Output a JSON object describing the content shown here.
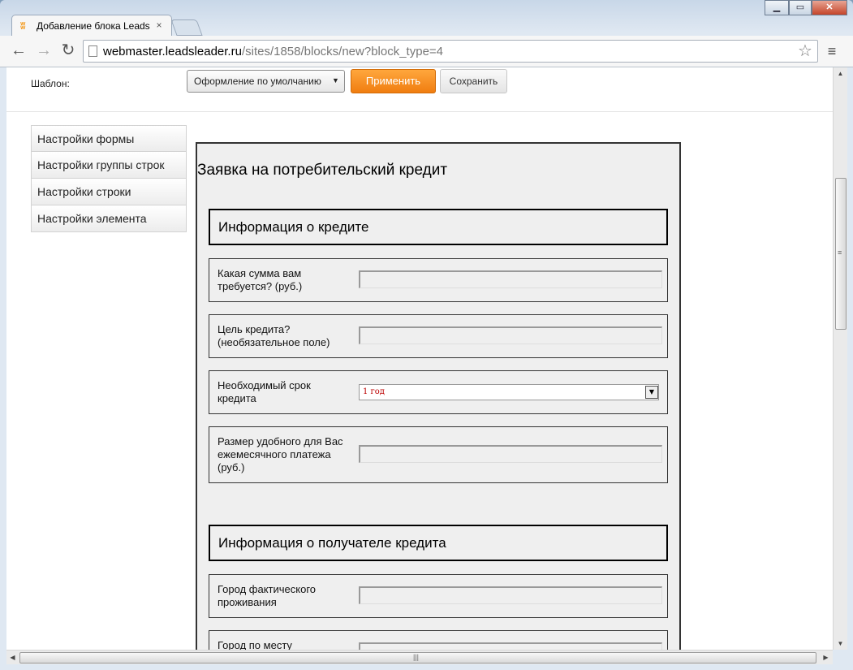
{
  "browser": {
    "tab_title": "Добавление блока Leadsl",
    "tab_close": "×",
    "url_host": "webmaster.leadsleader.ru",
    "url_path": "/sites/1858/blocks/new?block_type=4"
  },
  "toolbar": {
    "template_label": "Шаблон:",
    "template_value": "Оформление по умолчанию",
    "apply_label": "Применить",
    "save_label": "Сохранить"
  },
  "sidebar": {
    "items": [
      {
        "label": "Настройки формы"
      },
      {
        "label": "Настройки группы строк"
      },
      {
        "label": "Настройки строки"
      },
      {
        "label": "Настройки элемента"
      }
    ]
  },
  "form": {
    "title": "Заявка на потребительский кредит",
    "sections": [
      {
        "title": "Информация о кредите",
        "rows": [
          {
            "label": "Какая сумма вам требуется? (руб.)",
            "type": "input"
          },
          {
            "label": "Цель кредита? (необязательное поле)",
            "type": "input"
          },
          {
            "label": "Необходимый срок кредита",
            "type": "select",
            "value": "1 год"
          },
          {
            "label": "Размер удобного для Вас ежемесячного платежа (руб.)",
            "type": "input"
          }
        ]
      },
      {
        "title": "Информация о получателе кредита",
        "rows": [
          {
            "label": "Город фактического проживания",
            "type": "input"
          },
          {
            "label": "Город по месту",
            "type": "input"
          }
        ]
      }
    ]
  },
  "colors": {
    "accent": "#f39a1e",
    "apply_button": "#f38a18"
  }
}
